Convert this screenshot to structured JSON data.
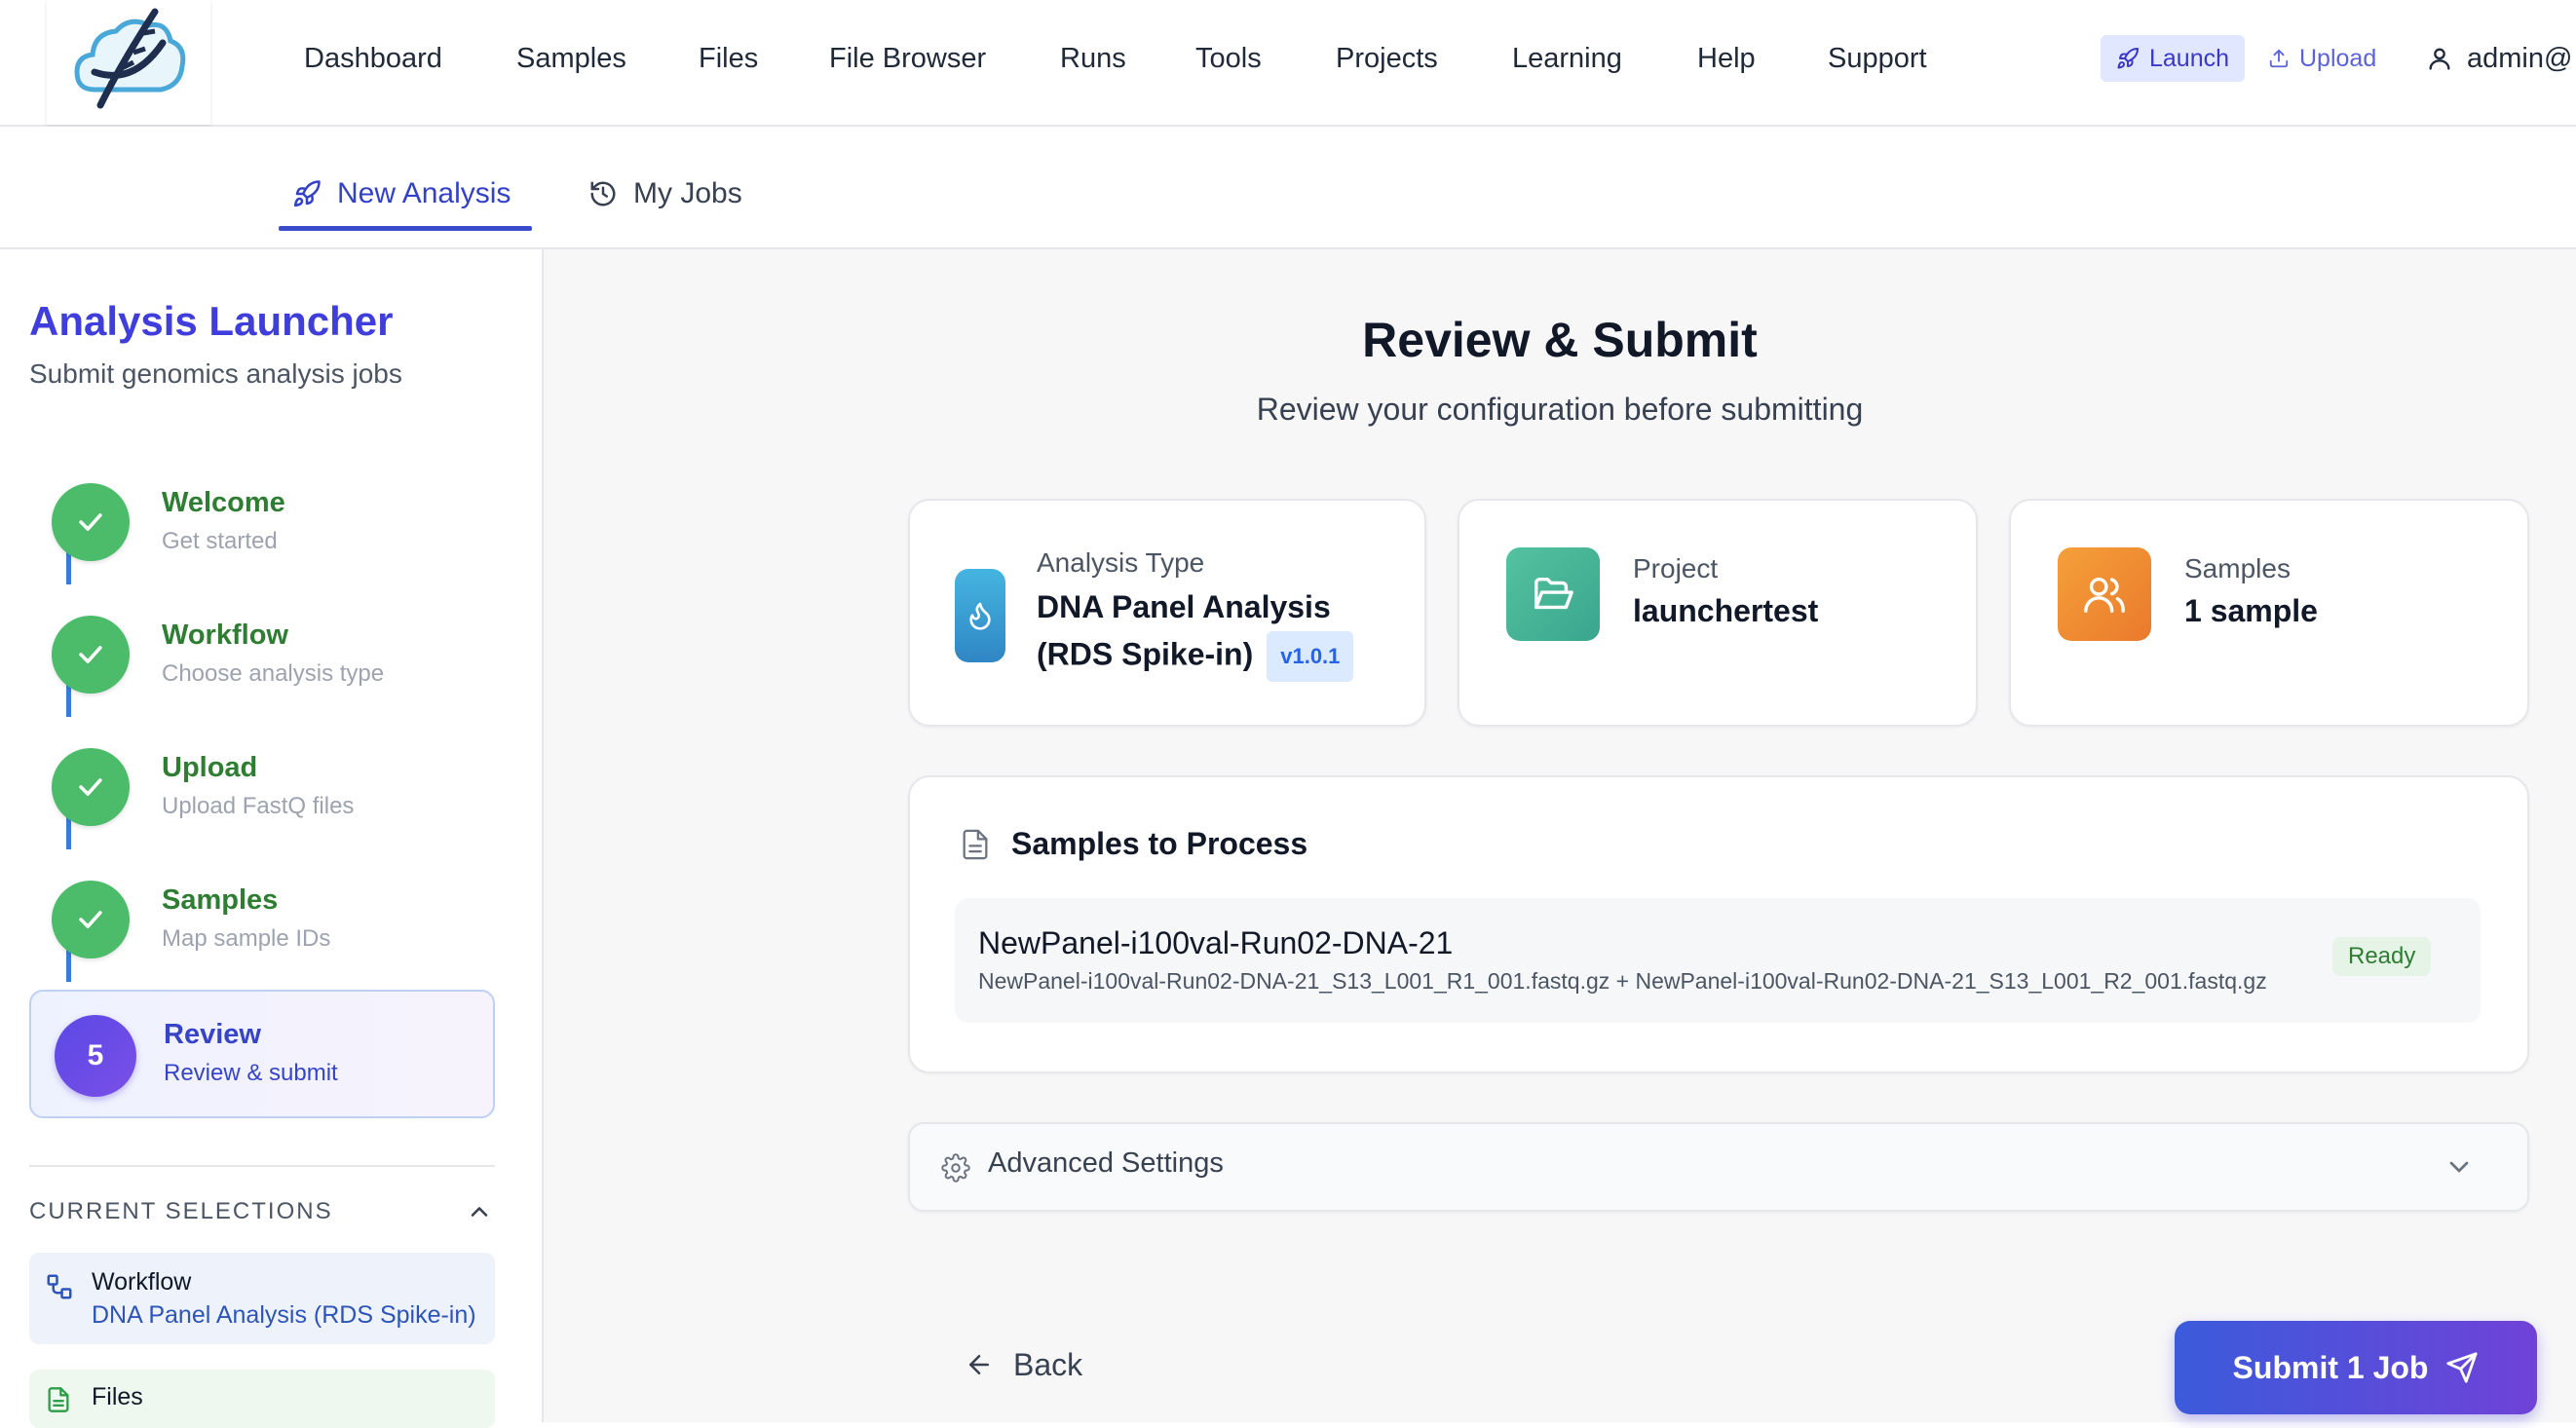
{
  "nav": {
    "items": [
      "Dashboard",
      "Samples",
      "Files",
      "File Browser",
      "Runs",
      "Tools",
      "Projects",
      "Learning",
      "Help",
      "Support"
    ],
    "launch_label": "Launch",
    "upload_label": "Upload",
    "user_label": "admin@"
  },
  "tabs": {
    "new_analysis": "New Analysis",
    "my_jobs": "My Jobs"
  },
  "sidebar": {
    "title": "Analysis Launcher",
    "subtitle": "Submit genomics analysis jobs",
    "steps": [
      {
        "title": "Welcome",
        "subtitle": "Get started",
        "status": "complete"
      },
      {
        "title": "Workflow",
        "subtitle": "Choose analysis type",
        "status": "complete"
      },
      {
        "title": "Upload",
        "subtitle": "Upload FastQ files",
        "status": "complete"
      },
      {
        "title": "Samples",
        "subtitle": "Map sample IDs",
        "status": "complete"
      },
      {
        "number": "5",
        "title": "Review",
        "subtitle": "Review & submit",
        "status": "active"
      }
    ],
    "current_selections": {
      "heading": "CURRENT SELECTIONS",
      "workflow_label": "Workflow",
      "workflow_value": "DNA Panel Analysis (RDS Spike-in)",
      "files_label": "Files"
    }
  },
  "main": {
    "title": "Review & Submit",
    "subtitle": "Review your configuration before submitting",
    "summary": {
      "analysis_type_label": "Analysis Type",
      "analysis_type_line1": "DNA Panel Analysis",
      "analysis_type_line2": "(RDS Spike-in)",
      "version": "v1.0.1",
      "project_label": "Project",
      "project_value": "launchertest",
      "samples_label": "Samples",
      "samples_value": "1 sample"
    },
    "samples_to_process": {
      "title": "Samples to Process",
      "rows": [
        {
          "name": "NewPanel-i100val-Run02-DNA-21",
          "files": "NewPanel-i100val-Run02-DNA-21_S13_L001_R1_001.fastq.gz + NewPanel-i100val-Run02-DNA-21_S13_L001_R2_001.fastq.gz",
          "status": "Ready"
        }
      ]
    },
    "advanced_settings_label": "Advanced Settings",
    "back_label": "Back",
    "submit_label": "Submit 1 Job"
  },
  "colors": {
    "accent": "#3f3ddc",
    "step_complete": "#4cbb6a",
    "analysis_icon": "#3aa0d4",
    "project_icon": "#4cb89a",
    "samples_icon": "#f08c2e"
  },
  "icons": {
    "logo": "dna-cloud-logo",
    "launch": "rocket-icon",
    "upload": "upload-icon",
    "user": "user-icon",
    "my_jobs": "history-icon",
    "analysis_type": "flame-icon",
    "project": "folder-open-icon",
    "samples": "users-icon",
    "samples_to_process": "document-icon",
    "advanced_settings": "gear-icon",
    "back": "arrow-left-icon",
    "submit": "send-icon"
  }
}
